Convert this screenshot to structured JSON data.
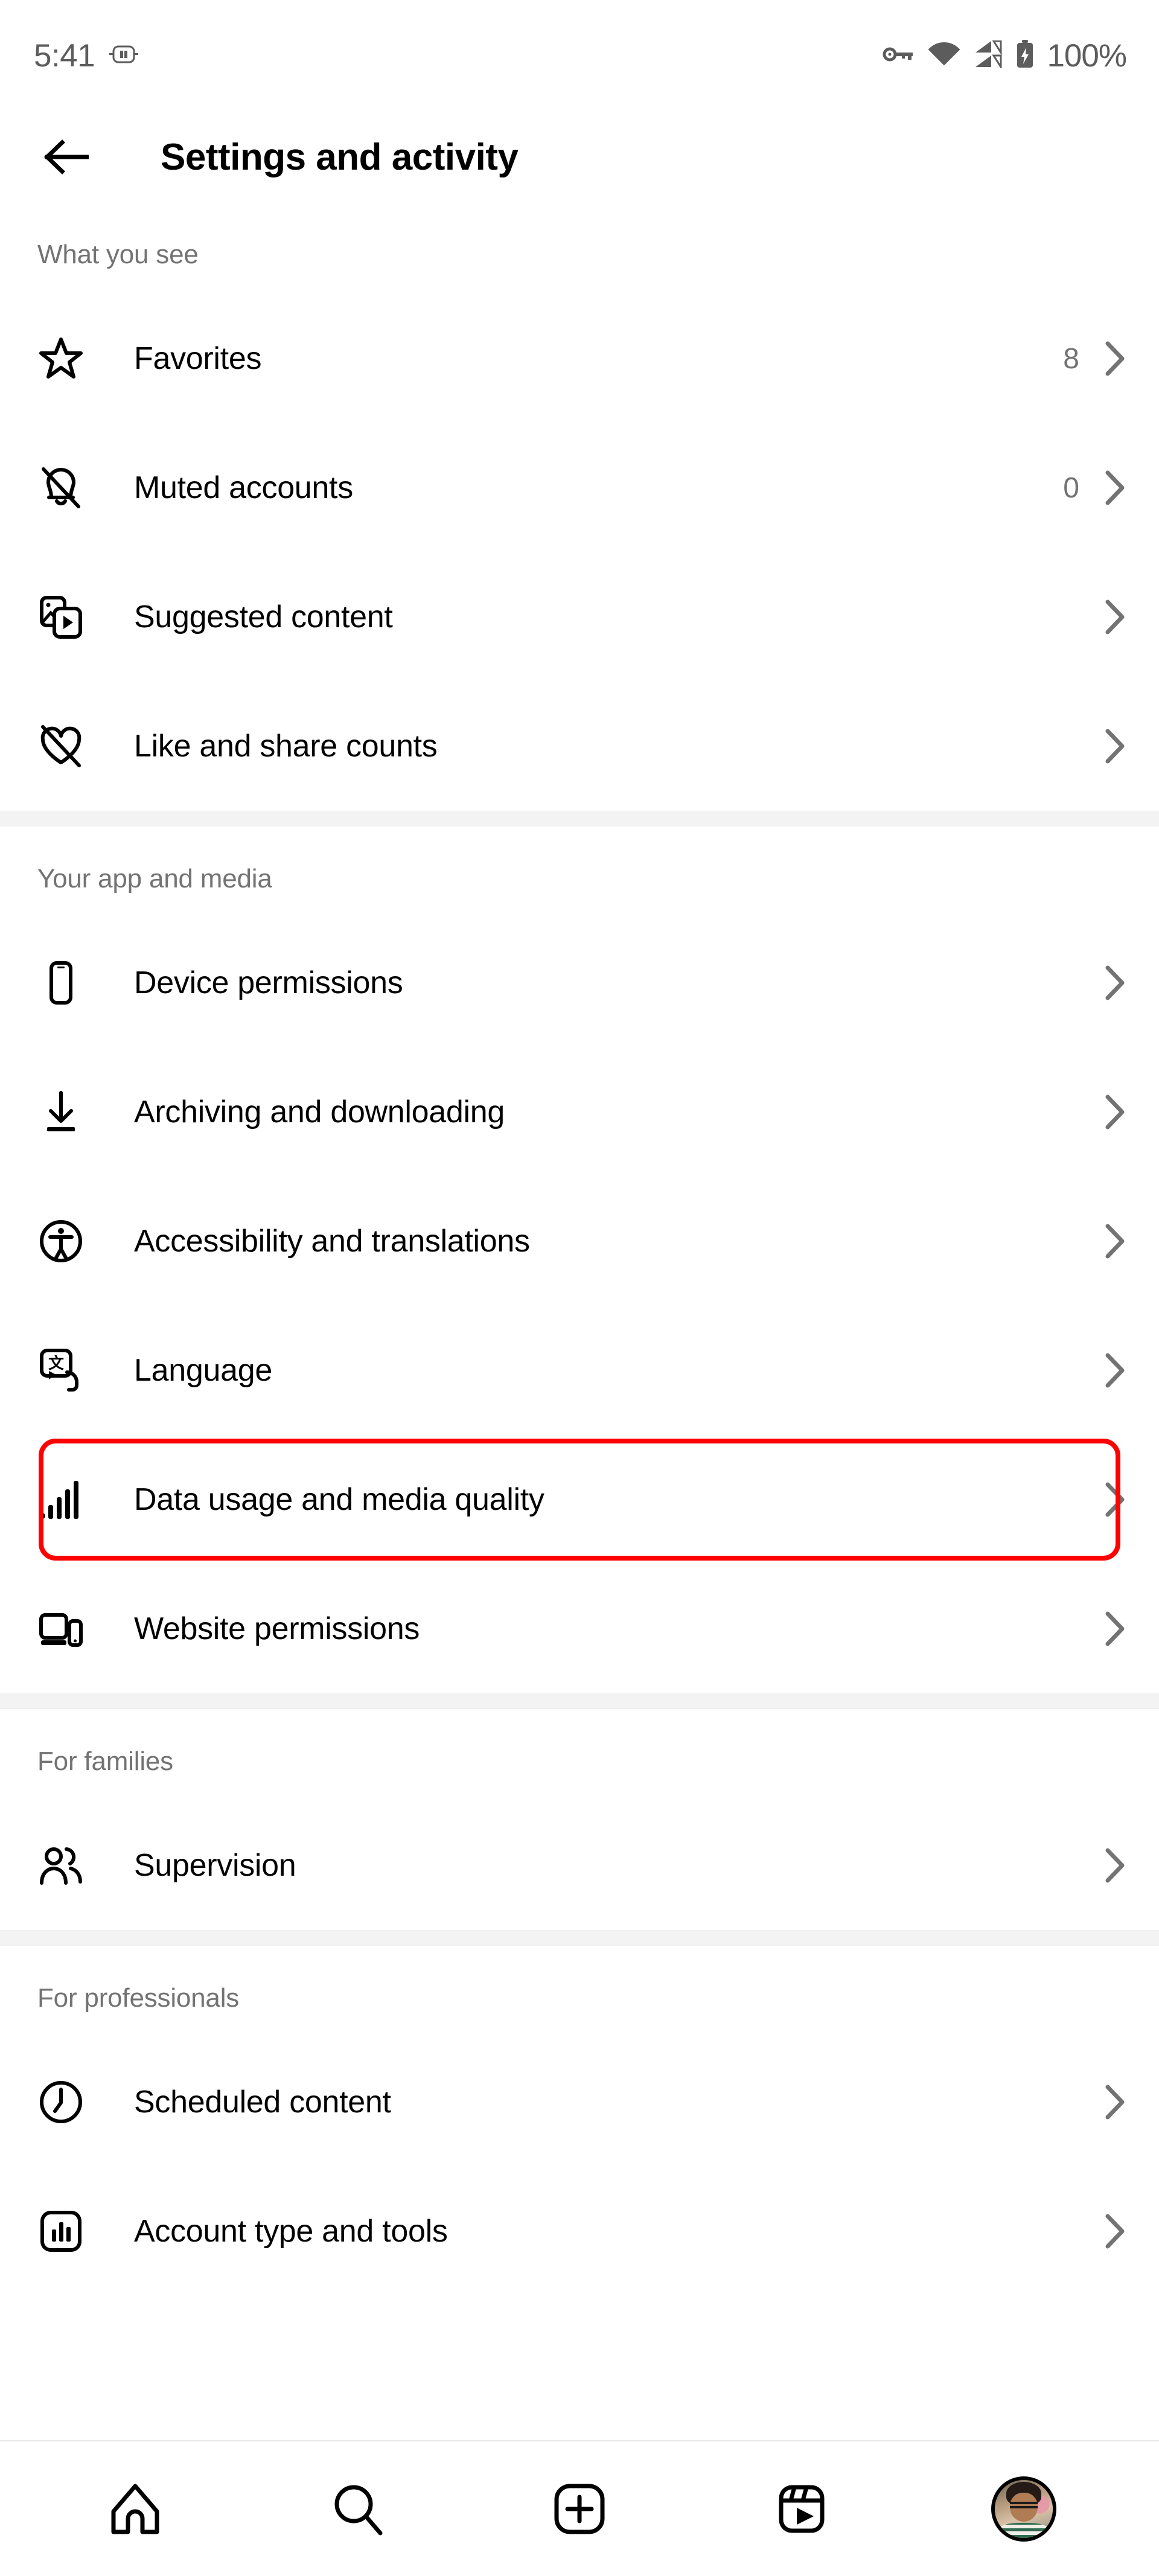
{
  "statusbar": {
    "time": "5:41",
    "battery_percent": "100%",
    "icons": [
      "dual-sim-icon",
      "vpn-key-icon",
      "wifi-icon",
      "cellular-signal-icon",
      "battery-charging-icon"
    ]
  },
  "header": {
    "back_icon": "back-arrow-icon",
    "title": "Settings and activity"
  },
  "sections": [
    {
      "title": "What you see",
      "items": [
        {
          "label": "Favorites",
          "icon": "star-icon",
          "count": "8"
        },
        {
          "label": "Muted accounts",
          "icon": "bell-slash-icon",
          "count": "0"
        },
        {
          "label": "Suggested content",
          "icon": "suggested-content-icon",
          "count": ""
        },
        {
          "label": "Like and share counts",
          "icon": "heart-slash-icon",
          "count": ""
        }
      ]
    },
    {
      "title": "Your app and media",
      "items": [
        {
          "label": "Device permissions",
          "icon": "phone-icon",
          "count": ""
        },
        {
          "label": "Archiving and downloading",
          "icon": "download-icon",
          "count": ""
        },
        {
          "label": "Accessibility and translations",
          "icon": "accessibility-icon",
          "count": ""
        },
        {
          "label": "Language",
          "icon": "translate-icon",
          "count": ""
        },
        {
          "label": "Data usage and media quality",
          "icon": "signal-bars-icon",
          "count": "",
          "highlighted": true
        },
        {
          "label": "Website permissions",
          "icon": "browser-icon",
          "count": ""
        }
      ]
    },
    {
      "title": "For families",
      "items": [
        {
          "label": "Supervision",
          "icon": "people-icon",
          "count": ""
        }
      ]
    },
    {
      "title": "For professionals",
      "items": [
        {
          "label": "Scheduled content",
          "icon": "clock-icon",
          "count": ""
        },
        {
          "label": "Account type and tools",
          "icon": "bar-chart-icon",
          "count": ""
        }
      ]
    }
  ],
  "bottom_nav": [
    {
      "icon": "home-icon",
      "label": "Home"
    },
    {
      "icon": "search-icon",
      "label": "Search"
    },
    {
      "icon": "create-icon",
      "label": "Create"
    },
    {
      "icon": "reels-icon",
      "label": "Reels"
    },
    {
      "icon": "profile-avatar",
      "label": "Profile"
    }
  ],
  "colors": {
    "highlight": "#FF0000",
    "text_primary": "#000000",
    "text_secondary": "#737373",
    "divider": "#F3F3F3"
  }
}
